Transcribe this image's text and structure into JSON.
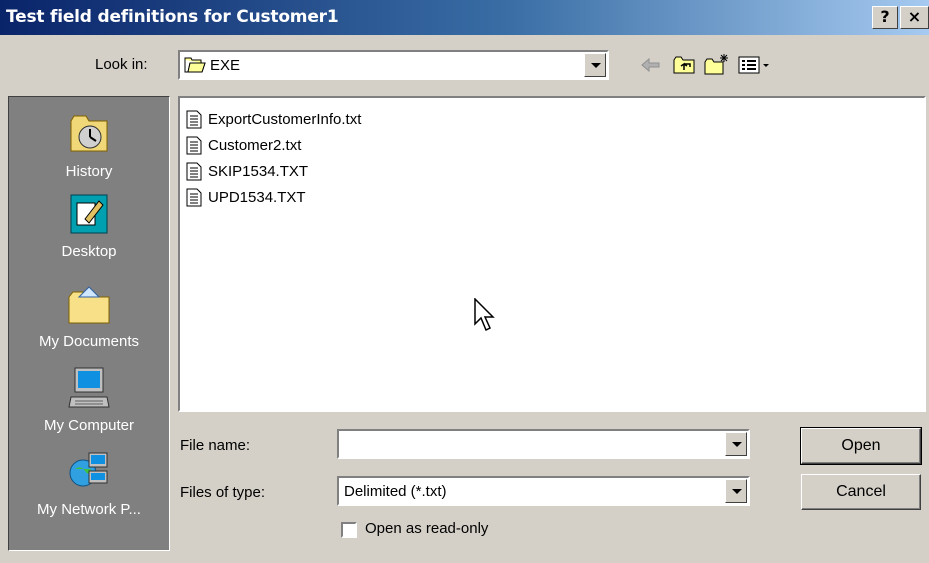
{
  "window": {
    "title": "Test field definitions for Customer1",
    "help_label": "?",
    "close_label": "×"
  },
  "look_in": {
    "label": "Look in:",
    "value": "EXE",
    "icon": "folder-open-icon"
  },
  "toolbar": {
    "icons": [
      "back-arrow-icon",
      "up-folder-icon",
      "new-folder-icon",
      "view-menu-icon"
    ]
  },
  "places": [
    {
      "label": "History",
      "icon": "history-icon"
    },
    {
      "label": "Desktop",
      "icon": "desktop-icon"
    },
    {
      "label": "My Documents",
      "icon": "my-documents-icon"
    },
    {
      "label": "My Computer",
      "icon": "my-computer-icon"
    },
    {
      "label": "My Network P...",
      "icon": "network-places-icon"
    }
  ],
  "files": [
    {
      "name": "ExportCustomerInfo.txt",
      "icon": "text-file-icon"
    },
    {
      "name": "Customer2.txt",
      "icon": "text-file-icon"
    },
    {
      "name": "SKIP1534.TXT",
      "icon": "text-file-icon"
    },
    {
      "name": "UPD1534.TXT",
      "icon": "text-file-icon"
    }
  ],
  "file_name": {
    "label": "File name:",
    "value": ""
  },
  "file_type": {
    "label": "Files of type:",
    "value": "Delimited (*.txt)"
  },
  "read_only": {
    "label": "Open as read-only",
    "checked": false
  },
  "buttons": {
    "open": "Open",
    "cancel": "Cancel"
  },
  "colors": {
    "title_start": "#0a246a",
    "title_end": "#a6caf0",
    "face": "#d4d0c8",
    "sidebar": "#808080"
  }
}
